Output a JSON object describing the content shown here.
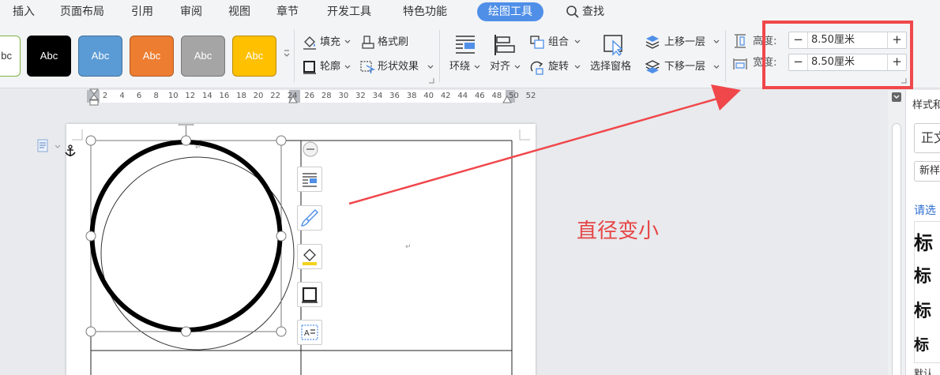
{
  "tabs": [
    {
      "label": "插入"
    },
    {
      "label": "页面布局"
    },
    {
      "label": "引用"
    },
    {
      "label": "审阅"
    },
    {
      "label": "视图"
    },
    {
      "label": "章节"
    },
    {
      "label": "开发工具"
    },
    {
      "label": "特色功能"
    },
    {
      "label": "绘图工具"
    },
    {
      "label": "查找"
    }
  ],
  "shape_styles": [
    "bc",
    "Abc",
    "Abc",
    "Abc",
    "Abc",
    "Abc"
  ],
  "ribbon": {
    "fill": "填充",
    "format_painter": "格式刷",
    "outline": "轮廓",
    "shape_effects": "形状效果",
    "wrap": "环绕",
    "align": "对齐",
    "group": "组合",
    "rotate": "旋转",
    "selection_pane": "选择窗格",
    "bring_forward": "上移一层",
    "send_backward": "下移一层",
    "height_label": "高度:",
    "width_label": "宽度:",
    "height_value": "8.50厘米",
    "width_value": "8.50厘米",
    "minus": "−",
    "plus": "+"
  },
  "ruler_ticks": [
    "2",
    "4",
    "6",
    "8",
    "10",
    "12",
    "14",
    "16",
    "18",
    "20",
    "22",
    "24",
    "26",
    "28",
    "30",
    "32",
    "34",
    "36",
    "38",
    "40",
    "42",
    "44",
    "46",
    "48",
    "50",
    "52"
  ],
  "right_pane": {
    "title": "样式和",
    "style_value": "正文",
    "new_style": "新样",
    "please_select": "请选",
    "headings": [
      "标",
      "标",
      "标",
      "标"
    ],
    "default": "默认"
  },
  "annotation": "直径变小",
  "colors": {
    "accent": "#4f8fe8",
    "highlight": "#f0474b",
    "annotation": "#e64545"
  }
}
